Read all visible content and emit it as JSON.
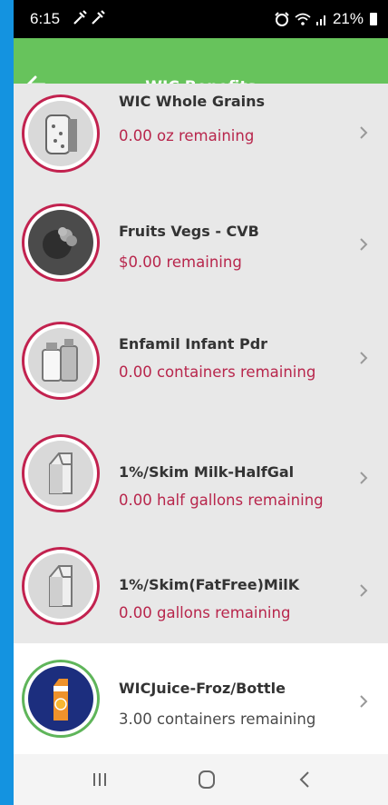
{
  "status_bar": {
    "time": "6:15",
    "battery": "21%"
  },
  "header": {
    "title": "WIC Benefits"
  },
  "items": [
    {
      "name": "WIC Whole Grains",
      "remaining": "0.00 oz remaining",
      "icon": "whole-grains-icon"
    },
    {
      "name": "Fruits Vegs - CVB",
      "remaining": "$0.00 remaining",
      "icon": "fruits-vegs-icon"
    },
    {
      "name": "Enfamil Infant Pdr",
      "remaining": "0.00 containers remaining",
      "icon": "infant-formula-icon"
    },
    {
      "name": "1%/Skim Milk-HalfGal",
      "remaining": "0.00 half gallons remaining",
      "icon": "milk-carton-icon"
    },
    {
      "name": "1%/Skim(FatFree)MilK",
      "remaining": "0.00 gallons remaining",
      "icon": "milk-carton-icon"
    },
    {
      "name": "WICJuice-Froz/Bottle",
      "remaining": "3.00 containers remaining",
      "icon": "juice-carton-icon"
    }
  ],
  "colors": {
    "accent_green": "#67c35c",
    "depleted_red": "#b8264c",
    "side_blue": "#1493e0"
  }
}
